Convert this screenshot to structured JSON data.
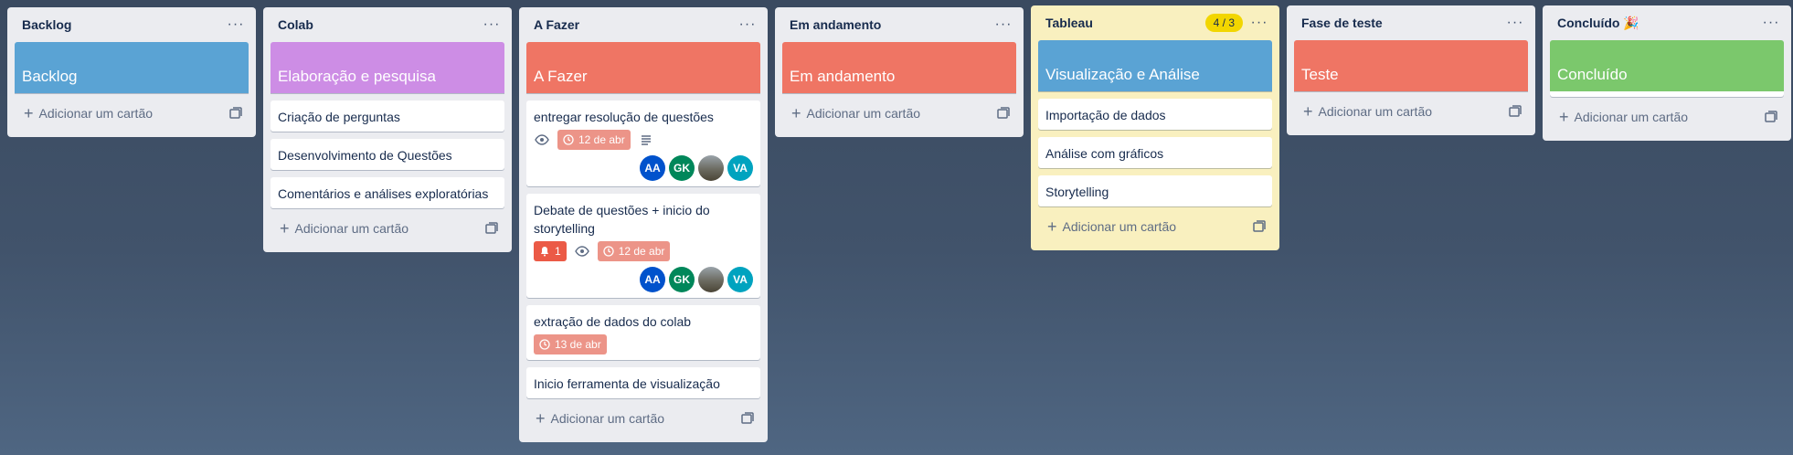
{
  "lists": [
    {
      "title": "Backlog",
      "cover": {
        "label": "Backlog",
        "color": "#5aa3d4"
      },
      "cards": [],
      "add_label": "Adicionar um cartão"
    },
    {
      "title": "Colab",
      "cover": {
        "label": "Elaboração e pesquisa",
        "color": "#cd8de5"
      },
      "cards": [
        {
          "title": "Criação de perguntas"
        },
        {
          "title": "Desenvolvimento de Questões"
        },
        {
          "title": "Comentários e análises exploratórias"
        }
      ],
      "add_label": "Adicionar um cartão"
    },
    {
      "title": "A Fazer",
      "cover": {
        "label": "A Fazer",
        "color": "#ef7564"
      },
      "cards": [
        {
          "title": "entregar resolução de questões",
          "due": "12 de abr",
          "members": [
            "AA",
            "GK",
            "",
            "VA"
          ]
        },
        {
          "title": "Debate de questões + inicio do storytelling",
          "notifications": "1",
          "due": "12 de abr",
          "members": [
            "AA",
            "GK",
            "",
            "VA"
          ]
        },
        {
          "title": "extração de dados do colab",
          "due": "13 de abr"
        },
        {
          "title": "Inicio ferramenta de visualização"
        }
      ],
      "add_label": "Adicionar um cartão"
    },
    {
      "title": "Em andamento",
      "cover": {
        "label": "Em andamento",
        "color": "#ef7564"
      },
      "cards": [],
      "add_label": "Adicionar um cartão"
    },
    {
      "title": "Tableau",
      "limit": "4 / 3",
      "cover": {
        "label": "Visualização e Análise",
        "color": "#5aa3d4"
      },
      "cards": [
        {
          "title": "Importação de dados"
        },
        {
          "title": "Análise com gráficos"
        },
        {
          "title": "Storytelling"
        }
      ],
      "add_label": "Adicionar um cartão"
    },
    {
      "title": "Fase de teste",
      "cover": {
        "label": "Teste",
        "color": "#ef7564"
      },
      "cards": [],
      "add_label": "Adicionar um cartão"
    },
    {
      "title": "Concluído 🎉",
      "cover": {
        "label": "Concluído",
        "color": "#7bc86c"
      },
      "cards": [],
      "add_label": "Adicionar um cartão"
    }
  ],
  "avatar_colors": {
    "AA": "#0052cc",
    "GK": "#00875a",
    "VA": "#00a3bf",
    "photo": "#5a5a55"
  }
}
